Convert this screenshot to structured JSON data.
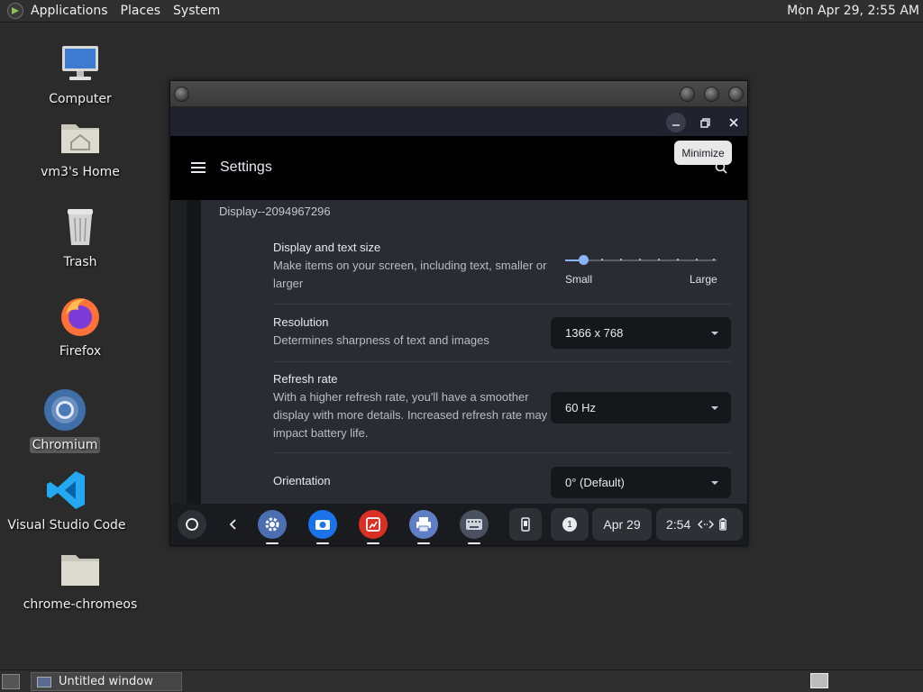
{
  "topbar": {
    "menus": [
      "Applications",
      "Places",
      "System"
    ],
    "clock": "Mon Apr 29,  2:55 AM"
  },
  "desktop_icons": [
    {
      "label": "Computer",
      "icon": "computer-icon"
    },
    {
      "label": "vm3's Home",
      "icon": "home-folder-icon"
    },
    {
      "label": "Trash",
      "icon": "trash-icon"
    },
    {
      "label": "Firefox",
      "icon": "firefox-icon"
    },
    {
      "label": "Chromium",
      "icon": "chromium-icon",
      "selected": true
    },
    {
      "label": "Visual Studio Code",
      "icon": "vscode-icon"
    },
    {
      "label": "chrome-chromeos",
      "icon": "folder-icon"
    }
  ],
  "window": {
    "tooltip": "Minimize",
    "settings_title": "Settings",
    "display_name": "Display--2094967296",
    "display_size": {
      "title": "Display and text size",
      "desc_line1": "Make items on your screen, including text, smaller or",
      "desc_line2": "larger",
      "label_small": "Small",
      "label_large": "Large",
      "level": 0.12
    },
    "resolution": {
      "title": "Resolution",
      "desc": "Determines sharpness of text and images",
      "value": "1366 x 768"
    },
    "refresh": {
      "title": "Refresh rate",
      "desc_line1": "With a higher refresh rate, you'll have a smoother",
      "desc_line2": "display with more details. Increased refresh rate may",
      "desc_line3": "impact battery life.",
      "value": "60 Hz"
    },
    "orientation": {
      "title": "Orientation",
      "value": "0° (Default)"
    },
    "shelf": {
      "notification_count": "1",
      "date": "Apr 29",
      "time": "2:54"
    }
  },
  "bottombar": {
    "task_label": "Untitled window"
  },
  "colors": {
    "accent": "#8ab4f8",
    "desktop_bg": "#2b2b2b",
    "panel_bg": "#2f2f2f"
  }
}
